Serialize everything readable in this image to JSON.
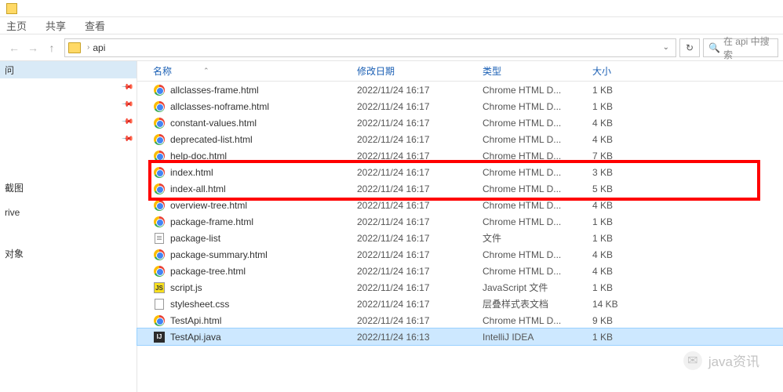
{
  "ribbon": {
    "home": "主页",
    "share": "共享",
    "view": "查看"
  },
  "address": {
    "path": "api",
    "search_placeholder": "在 api 中搜索"
  },
  "sidebar": {
    "quick": "问",
    "items": [
      "",
      "",
      "",
      ""
    ],
    "screenshot": "截图",
    "drive": "rive",
    "objects": "对象"
  },
  "columns": {
    "name": "名称",
    "date": "修改日期",
    "type": "类型",
    "size": "大小"
  },
  "files": [
    {
      "icon": "chrome",
      "name": "allclasses-frame.html",
      "date": "2022/11/24 16:17",
      "type": "Chrome HTML D...",
      "size": "1 KB"
    },
    {
      "icon": "chrome",
      "name": "allclasses-noframe.html",
      "date": "2022/11/24 16:17",
      "type": "Chrome HTML D...",
      "size": "1 KB"
    },
    {
      "icon": "chrome",
      "name": "constant-values.html",
      "date": "2022/11/24 16:17",
      "type": "Chrome HTML D...",
      "size": "4 KB"
    },
    {
      "icon": "chrome",
      "name": "deprecated-list.html",
      "date": "2022/11/24 16:17",
      "type": "Chrome HTML D...",
      "size": "4 KB"
    },
    {
      "icon": "chrome",
      "name": "help-doc.html",
      "date": "2022/11/24 16:17",
      "type": "Chrome HTML D...",
      "size": "7 KB"
    },
    {
      "icon": "chrome",
      "name": "index.html",
      "date": "2022/11/24 16:17",
      "type": "Chrome HTML D...",
      "size": "3 KB"
    },
    {
      "icon": "chrome",
      "name": "index-all.html",
      "date": "2022/11/24 16:17",
      "type": "Chrome HTML D...",
      "size": "5 KB"
    },
    {
      "icon": "chrome",
      "name": "overview-tree.html",
      "date": "2022/11/24 16:17",
      "type": "Chrome HTML D...",
      "size": "4 KB"
    },
    {
      "icon": "chrome",
      "name": "package-frame.html",
      "date": "2022/11/24 16:17",
      "type": "Chrome HTML D...",
      "size": "1 KB"
    },
    {
      "icon": "txt",
      "name": "package-list",
      "date": "2022/11/24 16:17",
      "type": "文件",
      "size": "1 KB"
    },
    {
      "icon": "chrome",
      "name": "package-summary.html",
      "date": "2022/11/24 16:17",
      "type": "Chrome HTML D...",
      "size": "4 KB"
    },
    {
      "icon": "chrome",
      "name": "package-tree.html",
      "date": "2022/11/24 16:17",
      "type": "Chrome HTML D...",
      "size": "4 KB"
    },
    {
      "icon": "js",
      "name": "script.js",
      "date": "2022/11/24 16:17",
      "type": "JavaScript 文件",
      "size": "1 KB"
    },
    {
      "icon": "css",
      "name": "stylesheet.css",
      "date": "2022/11/24 16:17",
      "type": "层叠样式表文档",
      "size": "14 KB"
    },
    {
      "icon": "chrome",
      "name": "TestApi.html",
      "date": "2022/11/24 16:17",
      "type": "Chrome HTML D...",
      "size": "9 KB"
    },
    {
      "icon": "ij",
      "name": "TestApi.java",
      "date": "2022/11/24 16:13",
      "type": "IntelliJ IDEA",
      "size": "1 KB",
      "selected": true
    }
  ],
  "watermark": "java资讯"
}
